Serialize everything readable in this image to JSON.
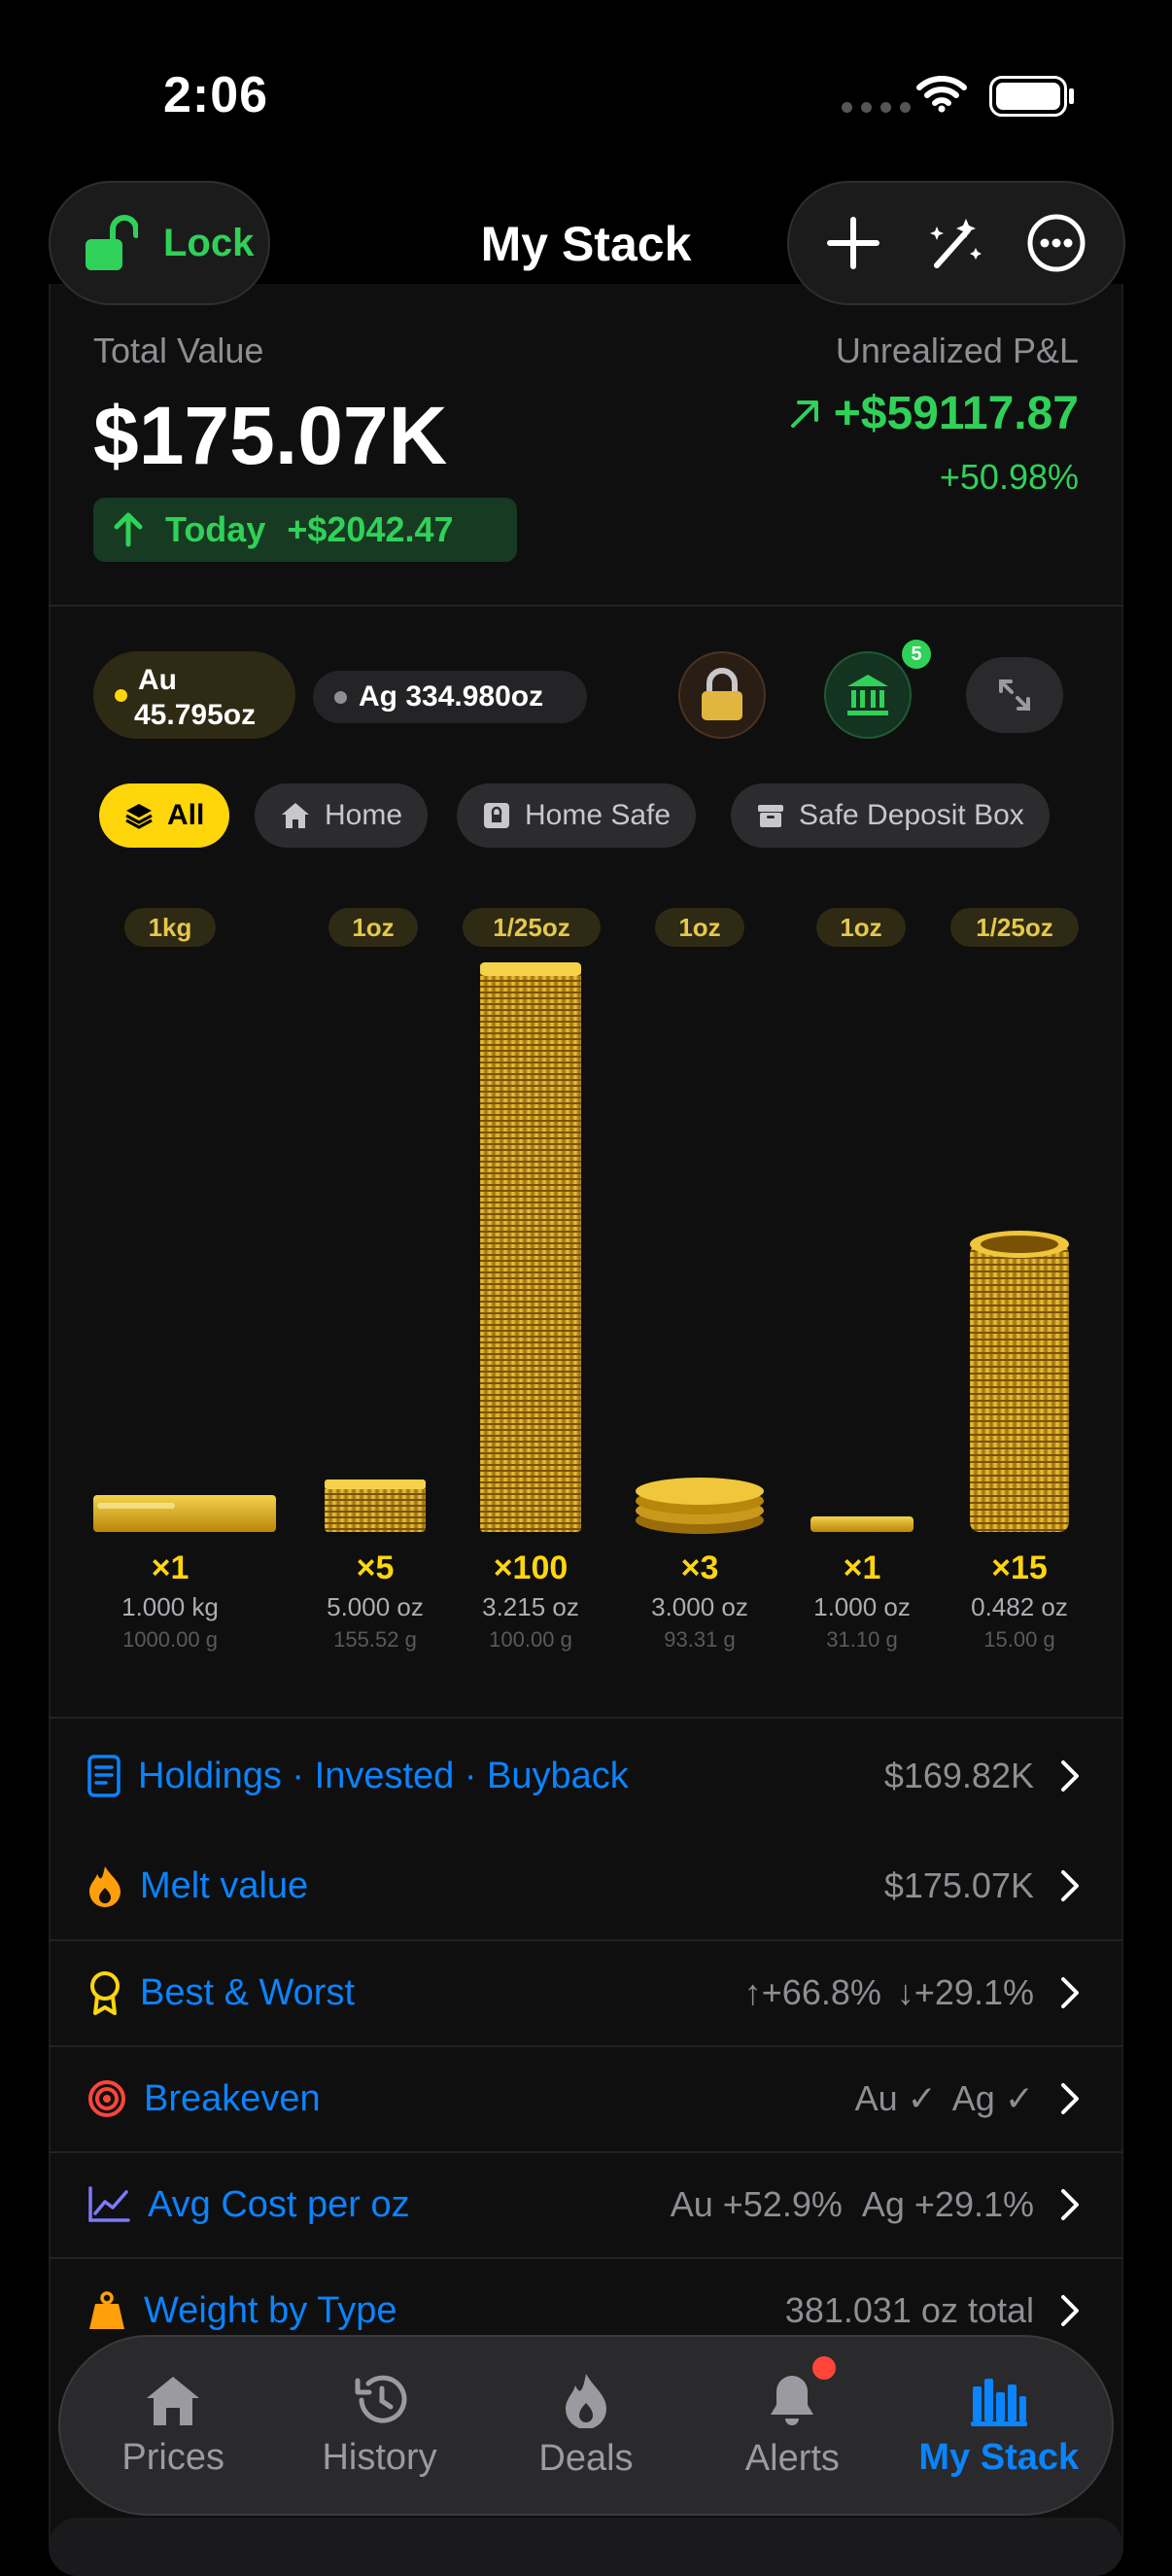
{
  "status_bar": {
    "time": "2:06"
  },
  "nav": {
    "lock_label": "Lock",
    "title": "My Stack"
  },
  "summary": {
    "total_value_label": "Total Value",
    "total_value": "$175.07K",
    "today_label": "Today",
    "today_change": "+$2042.47",
    "pl_label": "Unrealized P&L",
    "pl_value": "+$59117.87",
    "pl_percent": "+50.98%"
  },
  "metals": {
    "au_symbol": "Au",
    "au_amount": "45.795oz",
    "ag_text": "Ag 334.980oz",
    "bank_badge": "5"
  },
  "filters": [
    "All",
    "Home",
    "Home Safe",
    "Safe Deposit Box"
  ],
  "stacks": [
    {
      "size": "1kg",
      "count": "×1",
      "weight": "1.000 kg",
      "grams": "1000.00 g"
    },
    {
      "size": "1oz",
      "count": "×5",
      "weight": "5.000 oz",
      "grams": "155.52 g"
    },
    {
      "size": "1/25oz",
      "count": "×100",
      "weight": "3.215 oz",
      "grams": "100.00 g"
    },
    {
      "size": "1oz",
      "count": "×3",
      "weight": "3.000 oz",
      "grams": "93.31 g"
    },
    {
      "size": "1oz",
      "count": "×1",
      "weight": "1.000 oz",
      "grams": "31.10 g"
    },
    {
      "size": "1/25oz",
      "count": "×15",
      "weight": "0.482 oz",
      "grams": "15.00 g"
    }
  ],
  "rows": {
    "holdings": {
      "label": "Holdings · Invested · Buyback",
      "value": "$169.82K"
    },
    "melt": {
      "label": "Melt value",
      "value": "$175.07K"
    },
    "best_worst": {
      "label": "Best & Worst",
      "best": "↑+66.8%",
      "worst": "↓+29.1%"
    },
    "breakeven": {
      "label": "Breakeven",
      "au": "Au ✓",
      "ag": "Ag ✓"
    },
    "avg_cost": {
      "label": "Avg Cost per oz",
      "au": "Au +52.9%",
      "ag": "Ag +29.1%"
    },
    "weight_type": {
      "label": "Weight by Type",
      "value": "381.031 oz total"
    }
  },
  "tabs": [
    "Prices",
    "History",
    "Deals",
    "Alerts",
    "My Stack"
  ],
  "colors": {
    "accent": "#0a84ff",
    "gold": "#ffd60a",
    "positive": "#30d158",
    "negative": "#ff453a"
  }
}
